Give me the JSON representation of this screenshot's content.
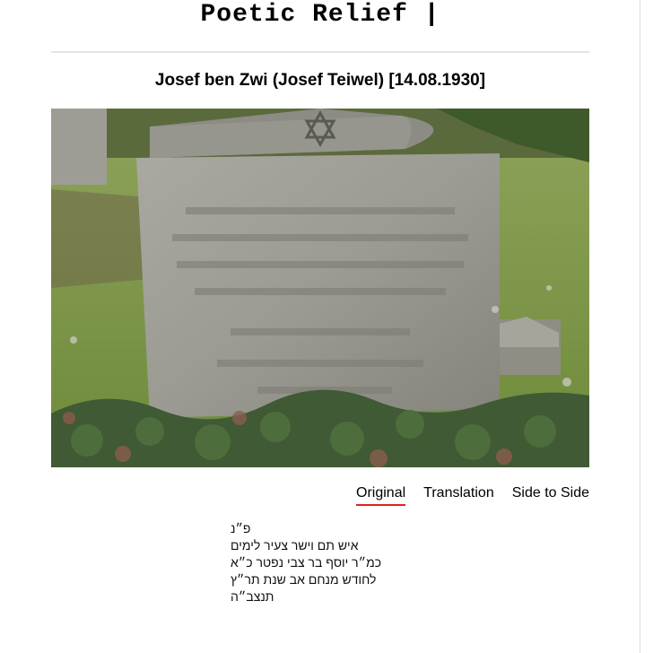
{
  "site": {
    "title": "Poetic Relief |"
  },
  "entry": {
    "heading": "Josef ben Zwi (Josef Teiwel) [14.08.1930]"
  },
  "photo": {
    "subject": "weathered gravestone with Star of David and Hebrew inscription, surrounded by ivy and moss"
  },
  "tabs": [
    {
      "label": "Original",
      "active": true
    },
    {
      "label": "Translation",
      "active": false
    },
    {
      "label": "Side to Side",
      "active": false
    }
  ],
  "inscription": {
    "lines": [
      "פ״נ",
      "איש תם וישר צעיר לימים",
      "כמ״ר יוסף בר צבי נפטר כ״א",
      "לחודש מנחם אב שנת תר״ץ",
      "תנצב״ה"
    ]
  },
  "colors": {
    "active_tab_underline": "#dd2222"
  }
}
